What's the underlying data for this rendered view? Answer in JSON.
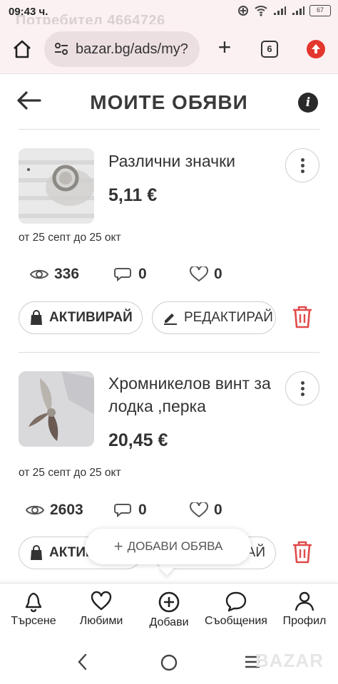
{
  "status_bar": {
    "time": "09:43 ч.",
    "ghost_text": "Потребител 4664726",
    "battery": "67"
  },
  "browser": {
    "url": "bazar.bg/ads/my?",
    "tab_count": "6"
  },
  "header": {
    "title": "МОИТЕ ОБЯВИ"
  },
  "ads": [
    {
      "title": "Различни значки",
      "price": "5,11 €",
      "dates": "от 25 септ до 25 окт",
      "views": "336",
      "messages": "0",
      "favorites": "0",
      "activate_label": "АКТИВИРАЙ",
      "edit_label": "РЕДАКТИРАЙ"
    },
    {
      "title": "Хромникелов винт за лодка ,перка",
      "price": "20,45 €",
      "dates": "от 25 септ до 25 окт",
      "views": "2603",
      "messages": "0",
      "favorites": "0",
      "activate_label": "АКТИВ",
      "edit_label": "АЙ"
    }
  ],
  "add_tooltip": {
    "label": "ДОБАВИ ОБЯВА"
  },
  "bottom_nav": {
    "items": [
      {
        "label": "Търсене",
        "icon": "bell-icon"
      },
      {
        "label": "Любими",
        "icon": "heart-icon"
      },
      {
        "label": "Добави",
        "icon": "plus-circle-icon"
      },
      {
        "label": "Съобщения",
        "icon": "chat-bubble-icon"
      },
      {
        "label": "Профил",
        "icon": "user-icon"
      }
    ]
  },
  "watermark": "BAZAR",
  "colors": {
    "accent_red": "#e14b4b",
    "browser_bg": "#fbf1f2",
    "text": "#333333"
  }
}
